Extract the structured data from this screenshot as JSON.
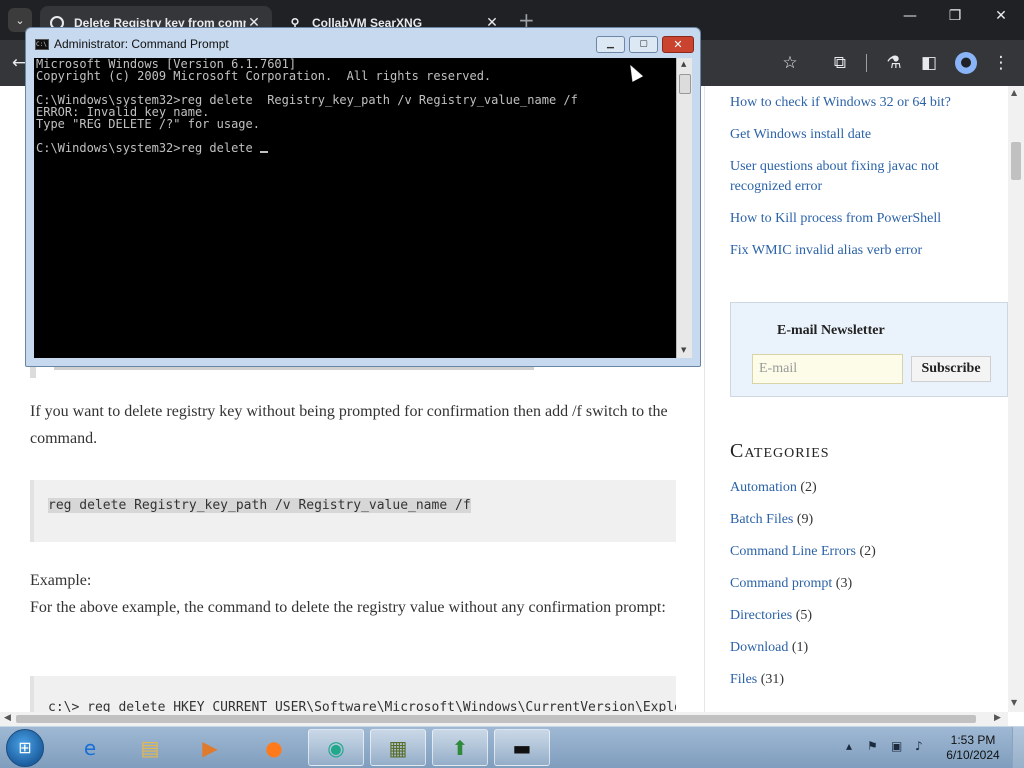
{
  "browser": {
    "tabs": [
      {
        "label": "Delete Registry key from comm",
        "active": true
      },
      {
        "label": "CollabVM SearXNG",
        "active": false
      }
    ],
    "new_tab_symbol": "+",
    "menu_symbol": "⌄"
  },
  "toolbar": {
    "back_icon": "←",
    "star_icon": "☆",
    "extensions_icon": "⧉",
    "labs_icon": "⚗",
    "sidepanel_icon": "◧",
    "profile_icon": "●",
    "menu_icon": "⋮"
  },
  "cmd": {
    "title": "Administrator: Command Prompt",
    "lines": [
      "Microsoft Windows [Version 6.1.7601]",
      "Copyright (c) 2009 Microsoft Corporation.  All rights reserved.",
      "",
      "C:\\Windows\\system32>reg delete  Registry_key_path /v Registry_value_name /f",
      "ERROR: Invalid key name.",
      "Type \"REG DELETE /?\" for usage.",
      "",
      "C:\\Windows\\system32>reg delete "
    ]
  },
  "article": {
    "para1": "If you want to delete registry key without being prompted for confirmation then add /f switch to the command.",
    "code1": "reg delete  Registry_key_path /v Registry_value_name /f",
    "example_label": "Example:",
    "para2": "For the above example, the command to delete the registry value without any confirmation prompt:",
    "code2": "c:\\> reg delete HKEY_CURRENT_USER\\Software\\Microsoft\\Windows\\CurrentVersion\\Explor"
  },
  "sidebar": {
    "links": [
      "How to check if Windows 32 or 64 bit?",
      "Get Windows install date",
      "User questions about fixing javac not recognized error",
      "How to Kill process from PowerShell",
      "Fix WMIC invalid alias verb error"
    ],
    "newsletter": {
      "title": "E-mail Newsletter",
      "placeholder": "E-mail",
      "button": "Subscribe"
    },
    "categories_title": "Categories",
    "categories": [
      {
        "name": "Automation",
        "count": "(2)"
      },
      {
        "name": "Batch Files",
        "count": "(9)"
      },
      {
        "name": "Command Line Errors",
        "count": "(2)"
      },
      {
        "name": "Command prompt",
        "count": "(3)"
      },
      {
        "name": "Directories",
        "count": "(5)"
      },
      {
        "name": "Download",
        "count": "(1)"
      },
      {
        "name": "Files",
        "count": "(31)"
      }
    ]
  },
  "taskbar": {
    "time": "1:53 PM",
    "date": "6/10/2024"
  }
}
